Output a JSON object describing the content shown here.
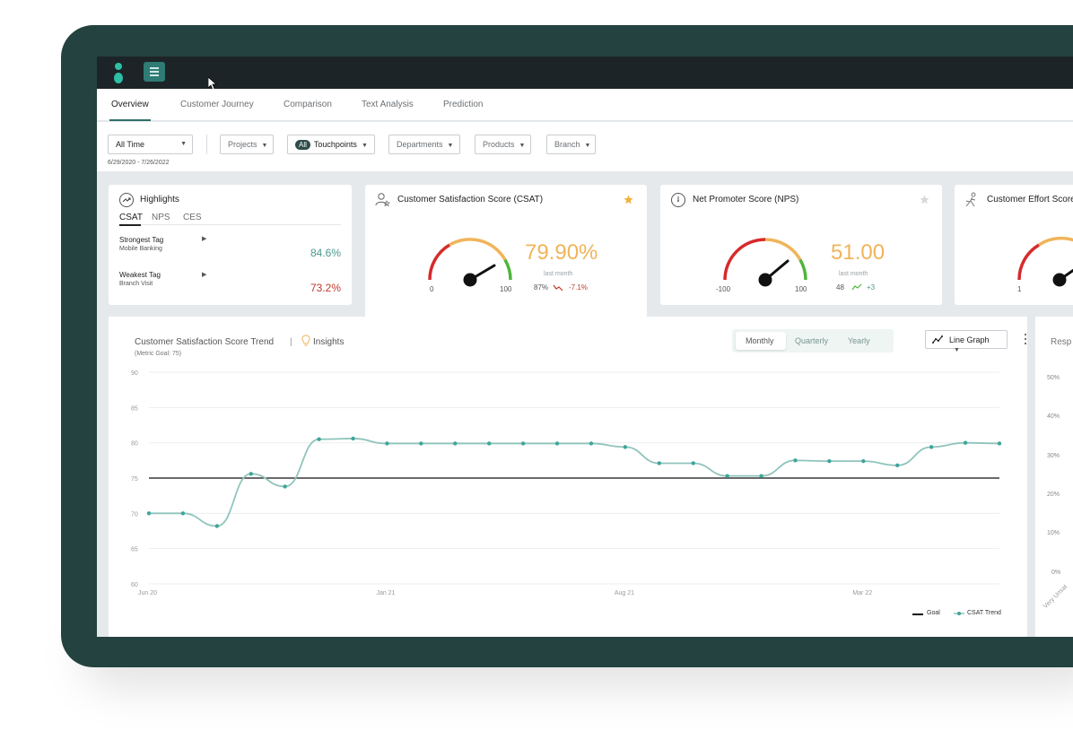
{
  "tabs": [
    "Overview",
    "Customer Journey",
    "Comparison",
    "Text Analysis",
    "Prediction"
  ],
  "filters": {
    "time": "All Time",
    "date_range": "6/29/2020 - 7/26/2022",
    "projects": "Projects",
    "all_pill": "All",
    "touchpoints": "Touchpoints",
    "departments": "Departments",
    "products": "Products",
    "branch": "Branch"
  },
  "highlights": {
    "title": "Highlights",
    "tabs": [
      "CSAT",
      "NPS",
      "CES"
    ],
    "strongest_label": "Strongest Tag",
    "strongest_sub": "Mobile Banking",
    "strongest_value": "84.6%",
    "weakest_label": "Weakest Tag",
    "weakest_sub": "Branch Visit",
    "weakest_value": "73.2%"
  },
  "csat": {
    "title": "Customer Satisfaction Score (CSAT)",
    "score": "79.90%",
    "min": "0",
    "max": "100",
    "last_month_label": "last month",
    "last_month_value": "87%",
    "change": "-7.1%",
    "gauge_value": 79.9
  },
  "nps": {
    "title": "Net Promoter Score (NPS)",
    "score": "51.00",
    "min": "-100",
    "max": "100",
    "last_month_label": "last month",
    "last_month_value": "48",
    "change": "+3",
    "gauge_value": 0.755
  },
  "ces": {
    "title": "Customer Effort Score",
    "min": "1"
  },
  "trend": {
    "title": "Customer Satisfaction Score Trend",
    "separator": "|",
    "insights": "Insights",
    "goal_note": "(Metric Goal: 75)",
    "periods": [
      "Monthly",
      "Quarterly",
      "Yearly"
    ],
    "view": "Line Graph",
    "legend_goal": "Goal",
    "legend_trend": "CSAT Trend"
  },
  "right_panel": {
    "title": "Resp",
    "ticks": [
      "50%",
      "40%",
      "30%",
      "20%",
      "10%",
      "0%"
    ],
    "axis_label": "Very Unsat"
  },
  "colors": {
    "accent": "#2f6f6a",
    "trend_line": "#8fc4bc",
    "trend_point": "#3fa59a",
    "positive": "#4a9a8d",
    "negative": "#c0392b",
    "score": "#f0b45a"
  },
  "chart_data": {
    "type": "line",
    "title": "Customer Satisfaction Score Trend",
    "subtitle": "(Metric Goal: 75)",
    "ylim": [
      60,
      90
    ],
    "yticks": [
      90,
      85,
      80,
      75,
      70,
      65,
      60
    ],
    "xticks": [
      "Jun 20",
      "Jan 21",
      "Aug 21",
      "Mar 22"
    ],
    "grid": true,
    "legend": "bottom-right",
    "goal": 75,
    "series": [
      {
        "name": "CSAT Trend",
        "values": [
          70,
          70,
          68.2,
          75.6,
          73.8,
          80.5,
          80.6,
          79.9,
          79.9,
          79.9,
          79.9,
          79.9,
          79.9,
          79.9,
          79.4,
          77.1,
          77.1,
          75.3,
          75.3,
          77.5,
          77.4,
          77.4,
          76.8,
          79.4,
          80,
          79.9
        ]
      }
    ]
  }
}
